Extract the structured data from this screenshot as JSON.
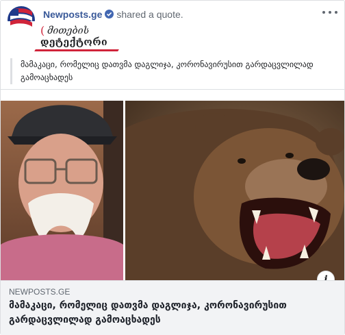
{
  "header": {
    "page_name": "Newposts.ge",
    "action_text": "shared a quote."
  },
  "logo": {
    "line1": "მითების",
    "line2": "დეტექტორი"
  },
  "quote": {
    "text": "მამაკაცი, რომელიც დათვმა დაგლიჯა, კორონავირუსით გარდაცვლილად გამოაცხადეს"
  },
  "link_preview": {
    "domain": "NEWPOSTS.GE",
    "title": "მამაკაცი, რომელიც დათვმა დაგლიჯა, კორონავირუსით გარდაცვლილად გამოაცხადეს",
    "info_label": "i"
  },
  "icons": {
    "verified": "verified-badge-icon",
    "more": "more-options-icon",
    "info": "info-icon"
  },
  "colors": {
    "link": "#385898",
    "verified": "#4267b2",
    "logo_accent": "#d0243a",
    "preview_bg": "#f2f3f5"
  }
}
